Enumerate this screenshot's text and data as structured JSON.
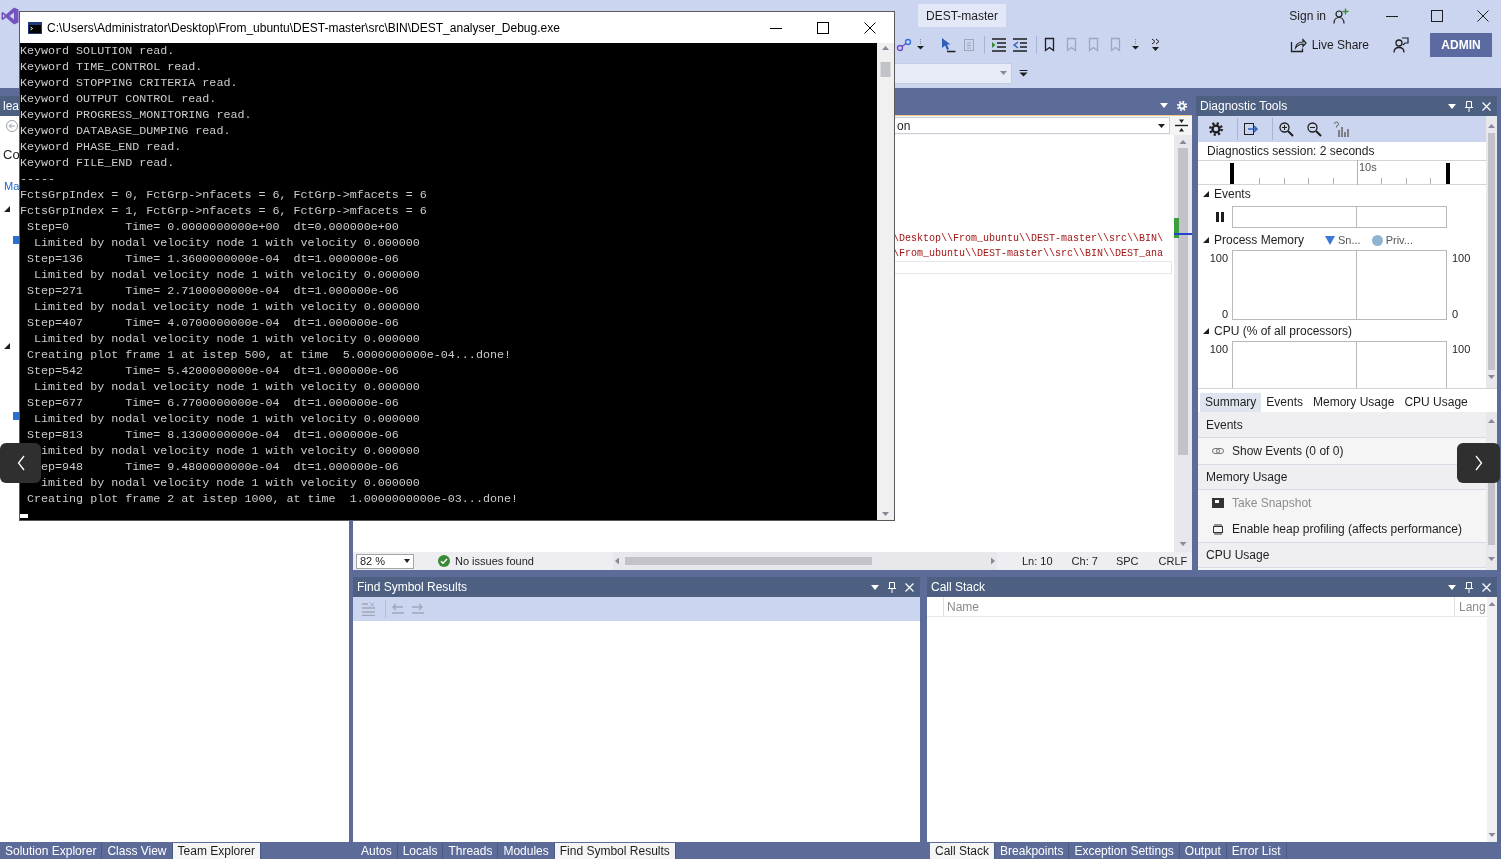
{
  "ide": {
    "title_bar": {
      "solution": "DEST-master",
      "sign_in": "Sign in"
    },
    "toolbar": {
      "live_share": "Live Share",
      "account": "ADMIN"
    },
    "team_explorer": {
      "title": "lea",
      "heading": "Co",
      "link": "Ma",
      "sections": [
        {
          "expanded": true
        },
        {
          "expanded": true
        }
      ]
    },
    "editor": {
      "navigation": "on",
      "code_lines": [
        "\\Desktop\\\\From_ubuntu\\\\DEST-master\\\\src\\\\BIN\\",
        "\\From_ubuntu\\\\DEST-master\\\\src\\\\BIN\\\\DEST_ana"
      ],
      "status": {
        "zoom": "82 %",
        "issues": "No issues found",
        "line": "Ln: 10",
        "column": "Ch: 7",
        "whitespace": "SPC",
        "line_ending": "CRLF"
      }
    },
    "diagnostic_tools": {
      "title": "Diagnostic Tools",
      "session": "Diagnostics session: 2 seconds",
      "ruler_label": "10s",
      "graphs": [
        {
          "kind": "events",
          "title": "Events",
          "expanded": true
        },
        {
          "kind": "memory",
          "title": "Process Memory",
          "expanded": true,
          "legend": [
            {
              "kind": "triangle",
              "label": "Sn...",
              "color": "#3b78d8"
            },
            {
              "kind": "circle",
              "label": "Priv...",
              "color": "#8fb4d2"
            }
          ],
          "left_ticks": [
            "100",
            "0"
          ],
          "right_ticks": [
            "100",
            "0"
          ]
        },
        {
          "kind": "cpu",
          "title": "CPU (% of all processors)",
          "expanded": true,
          "left_ticks": [
            "100"
          ],
          "right_ticks": [
            "100"
          ]
        }
      ],
      "tabs": [
        {
          "label": "Summary",
          "selected": true
        },
        {
          "label": "Events",
          "selected": false
        },
        {
          "label": "Memory Usage",
          "selected": false
        },
        {
          "label": "CPU Usage",
          "selected": false
        }
      ],
      "summary": [
        {
          "kind": "header",
          "text": "Events"
        },
        {
          "kind": "action",
          "text": "Show Events (0 of 0)",
          "disabled": false
        },
        {
          "kind": "header",
          "text": "Memory Usage"
        },
        {
          "kind": "action",
          "text": "Take Snapshot",
          "disabled": true
        },
        {
          "kind": "action",
          "text": "Enable heap profiling (affects performance)",
          "disabled": false
        },
        {
          "kind": "header",
          "text": "CPU Usage"
        }
      ]
    },
    "find_symbol_results": {
      "title": "Find Symbol Results"
    },
    "call_stack": {
      "title": "Call Stack",
      "columns": [
        "Name",
        "Lang"
      ]
    },
    "bottom_tab_groups": [
      [
        {
          "label": "Solution Explorer",
          "selected": false
        },
        {
          "label": "Class View",
          "selected": false
        },
        {
          "label": "Team Explorer",
          "selected": true
        }
      ],
      [
        {
          "label": "Autos",
          "selected": false
        },
        {
          "label": "Locals",
          "selected": false
        },
        {
          "label": "Threads",
          "selected": false
        },
        {
          "label": "Modules",
          "selected": false
        },
        {
          "label": "Find Symbol Results",
          "selected": true
        }
      ],
      [
        {
          "label": "Call Stack",
          "selected": true
        },
        {
          "label": "Breakpoints",
          "selected": false
        },
        {
          "label": "Exception Settings",
          "selected": false
        },
        {
          "label": "Output",
          "selected": false
        },
        {
          "label": "Error List",
          "selected": false
        }
      ]
    ]
  },
  "console": {
    "title": "C:\\Users\\Administrator\\Desktop\\From_ubuntu\\DEST-master\\src\\BIN\\DEST_analyser_Debug.exe",
    "lines": [
      {
        "kind": "full",
        "text": "Keyword SOLUTION read."
      },
      {
        "kind": "full",
        "text": "Keyword TIME_CONTROL read."
      },
      {
        "kind": "full",
        "text": "Keyword STOPPING CRITERIA read."
      },
      {
        "kind": "full",
        "text": "Keyword OUTPUT CONTROL read."
      },
      {
        "kind": "full",
        "text": "Keyword PROGRESS_MONITORING read."
      },
      {
        "kind": "full",
        "text": "Keyword DATABASE_DUMPING read."
      },
      {
        "kind": "full",
        "text": "Keyword PHASE_END read."
      },
      {
        "kind": "full",
        "text": "Keyword FILE_END read."
      },
      {
        "kind": "full",
        "text": "-----"
      },
      {
        "kind": "full",
        "text": "FctsGrpIndex = 0, FctGrp->nfacets = 6, FctGrp->mfacets = 6"
      },
      {
        "kind": "full",
        "text": "FctsGrpIndex = 1, FctGrp->nfacets = 6, FctGrp->mfacets = 6"
      },
      {
        "kind": "full",
        "text": " Step=0        Time= 0.0000000000e+00  dt=0.000000e+00"
      },
      {
        "kind": "full",
        "text": "  Limited by nodal velocity node 1 with velocity 0.000000"
      },
      {
        "kind": "full",
        "text": " Step=136      Time= 1.3600000000e-04  dt=1.000000e-06"
      },
      {
        "kind": "full",
        "text": "  Limited by nodal velocity node 1 with velocity 0.000000"
      },
      {
        "kind": "full",
        "text": " Step=271      Time= 2.7100000000e-04  dt=1.000000e-06"
      },
      {
        "kind": "full",
        "text": "  Limited by nodal velocity node 1 with velocity 0.000000"
      },
      {
        "kind": "full",
        "text": " Step=407      Time= 4.0700000000e-04  dt=1.000000e-06"
      },
      {
        "kind": "full",
        "text": "  Limited by nodal velocity node 1 with velocity 0.000000"
      },
      {
        "kind": "full",
        "text": " Creating plot frame 1 at istep 500, at time  5.0000000000e-04...done!"
      },
      {
        "kind": "full",
        "text": " Step=542      Time= 5.4200000000e-04  dt=1.000000e-06"
      },
      {
        "kind": "full",
        "text": "  Limited by nodal velocity node 1 with velocity 0.000000"
      },
      {
        "kind": "full",
        "text": " Step=677      Time= 6.7700000000e-04  dt=1.000000e-06"
      },
      {
        "kind": "full",
        "text": "  Limited by nodal velocity node 1 with velocity 0.000000"
      },
      {
        "kind": "full",
        "text": " Step=813      Time= 8.1300000000e-04  dt=1.000000e-06"
      },
      {
        "kind": "cut",
        "text": "imited by nodal velocity node 1 with velocity 0.000000"
      },
      {
        "kind": "cut",
        "text": "ep=948      Time= 9.4800000000e-04  dt=1.000000e-06"
      },
      {
        "kind": "cut",
        "text": "imited by nodal velocity node 1 with velocity 0.000000"
      },
      {
        "kind": "full",
        "text": " Creating plot frame 2 at istep 1000, at time  1.0000000000e-03...done!"
      }
    ]
  }
}
